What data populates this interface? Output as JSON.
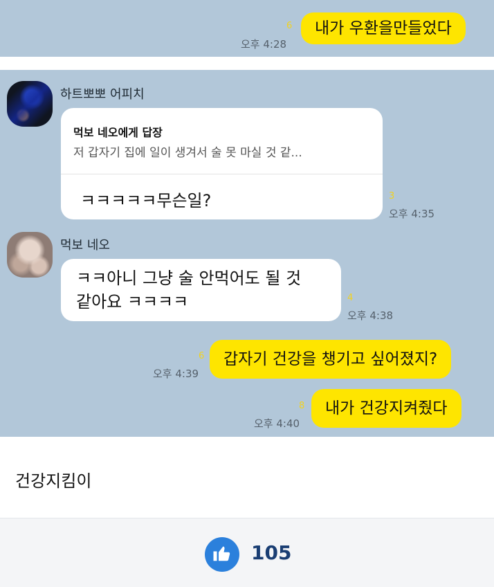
{
  "messages": {
    "m1": {
      "text": "내가 우환을만들었다",
      "unread": "6",
      "time": "오후 4:28"
    },
    "m2": {
      "sender": "하트뽀뽀 어피치",
      "reply_to": "먹보 네오에게 답장",
      "quoted": "저 갑자기 집에 일이 생겨서 술 못 마실 것 같...",
      "text": "ㅋㅋㅋㅋㅋ무슨일?",
      "unread": "3",
      "time": "오후 4:35"
    },
    "m3": {
      "sender": "먹보 네오",
      "line1": "ㅋㅋ아니 그냥 술 안먹어도 될 것",
      "line2": "같아요 ㅋㅋㅋㅋ",
      "unread": "4",
      "time": "오후 4:38"
    },
    "m4": {
      "text": "갑자기 건강을 챙기고 싶어졌지?",
      "unread": "6",
      "time": "오후 4:39"
    },
    "m5": {
      "text": "내가 건강지켜줬다",
      "unread": "8",
      "time": "오후 4:40"
    }
  },
  "caption": "건강지킴이",
  "likes": {
    "count": "105",
    "icon": "thumbs-up-icon"
  },
  "colors": {
    "chat_bg": "#b2c7d9",
    "my_bubble": "#fee500",
    "like_blue": "#2b80dc"
  }
}
